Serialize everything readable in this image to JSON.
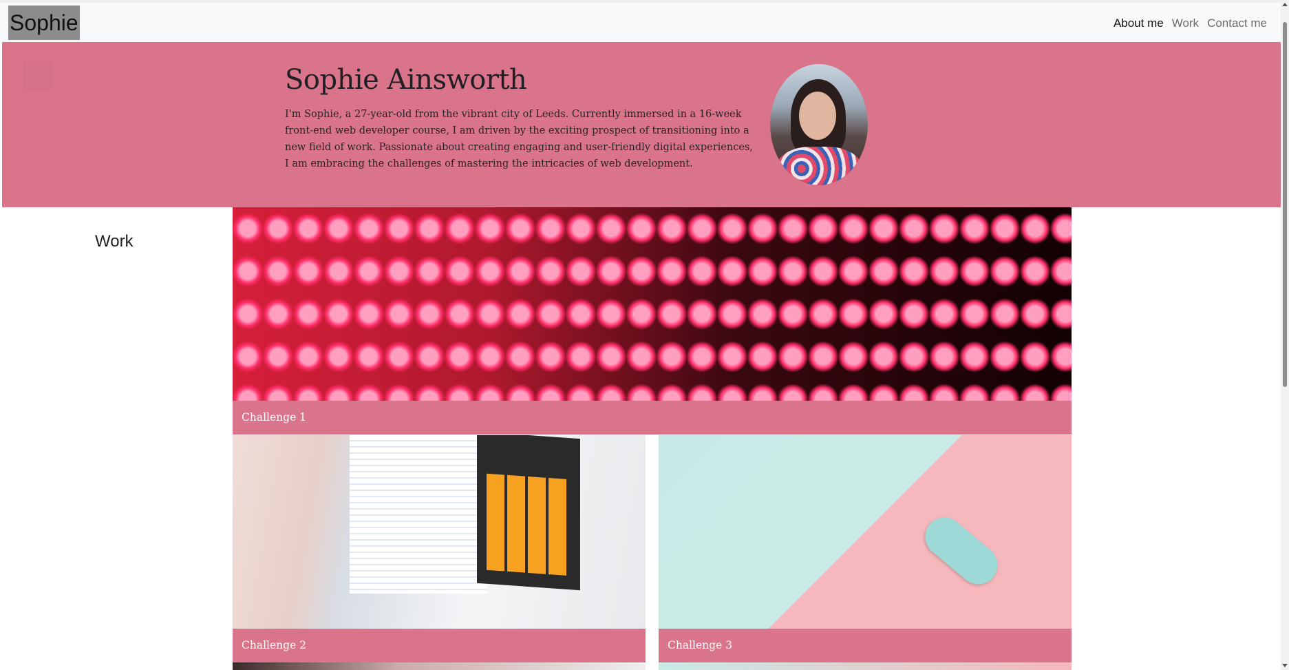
{
  "navbar": {
    "brand": "Sophie",
    "links": [
      {
        "label": "About me",
        "active": true
      },
      {
        "label": "Work",
        "active": false
      },
      {
        "label": "Contact me",
        "active": false
      }
    ]
  },
  "hero": {
    "name": "Sophie Ainsworth",
    "bio": "I'm Sophie, a 27-year-old from the vibrant city of Leeds. Currently immersed in a 16-week front-end web developer course, I am driven by the exciting prospect of transitioning into a new field of work. Passionate about creating engaging and user-friendly digital experiences, I am embracing the challenges of mastering the intricacies of web development.",
    "background_color": "#d9748a"
  },
  "work": {
    "heading": "Work",
    "cards": [
      {
        "caption": "Challenge 1",
        "image": "red-led-wall"
      },
      {
        "caption": "Challenge 2",
        "image": "laptop-calculator-code"
      },
      {
        "caption": "Challenge 3",
        "image": "toy-car-pastel"
      }
    ]
  },
  "colors": {
    "accent": "#d9748a",
    "navbar_bg": "#f8f9fa"
  }
}
